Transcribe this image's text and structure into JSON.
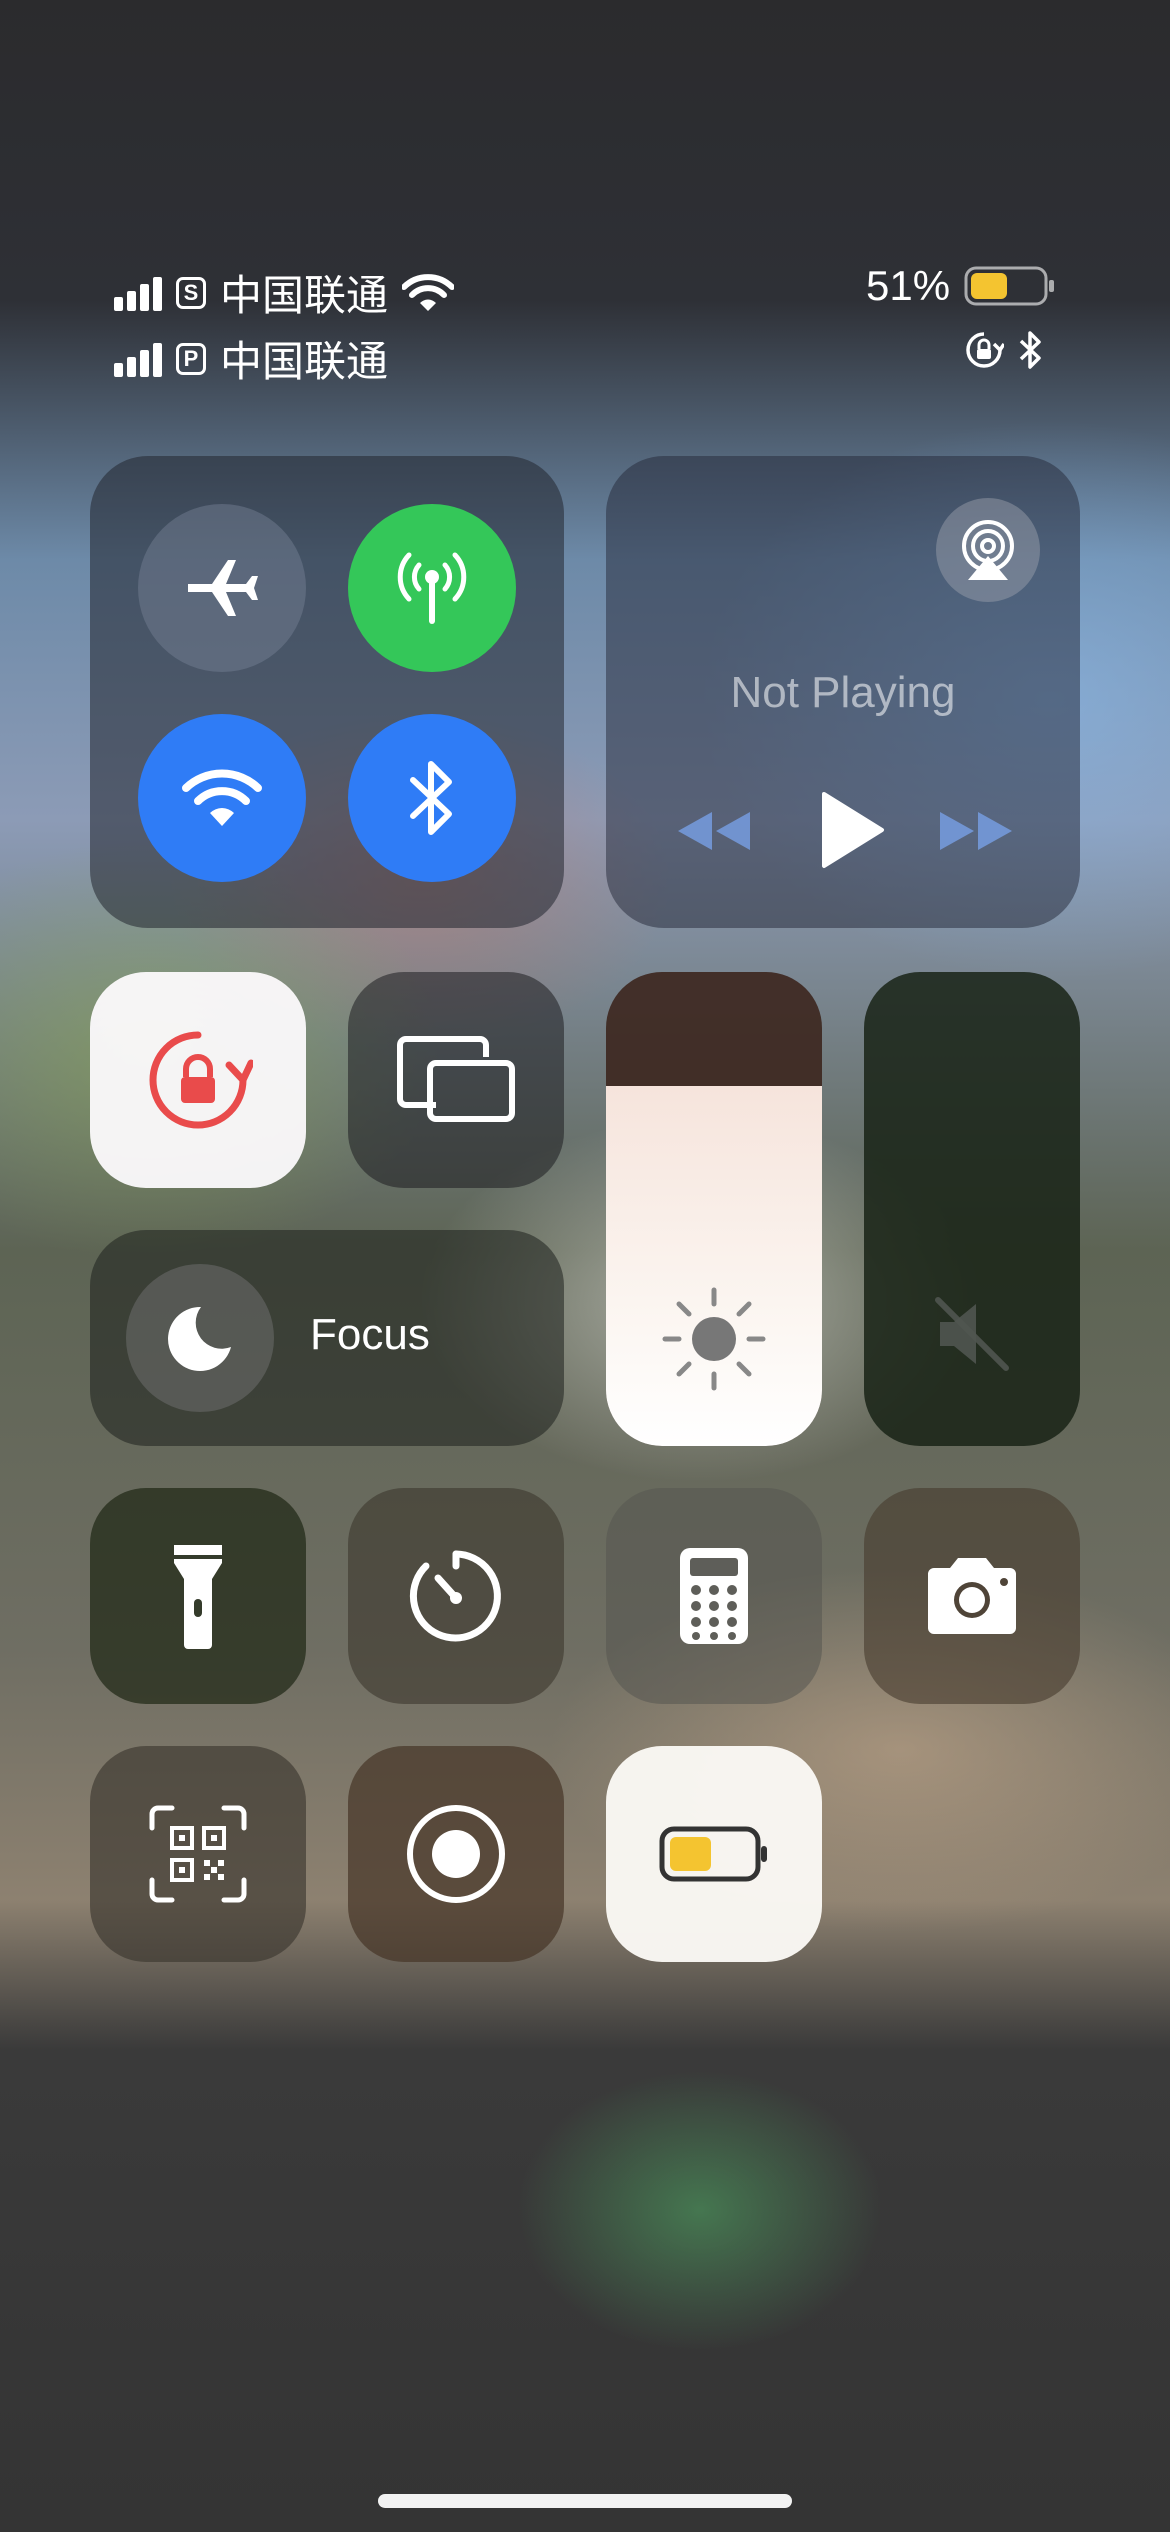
{
  "status_bar": {
    "sim1": {
      "badge": "S",
      "carrier": "中国联通"
    },
    "sim2": {
      "badge": "P",
      "carrier": "中国联通"
    },
    "battery_percent": "51%",
    "battery_level": 0.51
  },
  "connectivity": {
    "airplane": {
      "icon": "airplane-icon",
      "on": false
    },
    "cellular": {
      "icon": "antenna-icon",
      "on": true,
      "color": "#34c759"
    },
    "wifi": {
      "icon": "wifi-icon",
      "on": true,
      "color": "#2f7cf6"
    },
    "bluetooth": {
      "icon": "bluetooth-icon",
      "on": true,
      "color": "#2f7cf6"
    }
  },
  "media": {
    "status": "Not Playing",
    "airplay_icon": "airplay-icon",
    "rewind_icon": "rewind-icon",
    "play_icon": "play-icon",
    "forward_icon": "fast-forward-icon"
  },
  "focus": {
    "label": "Focus",
    "icon": "moon-icon"
  },
  "brightness": {
    "level": 0.76,
    "icon": "sun-icon"
  },
  "volume": {
    "level": 0.0,
    "icon": "speaker-muted-icon"
  },
  "accent": {
    "lock_red": "#e94b4b",
    "battery_yellow": "#f4c430"
  }
}
